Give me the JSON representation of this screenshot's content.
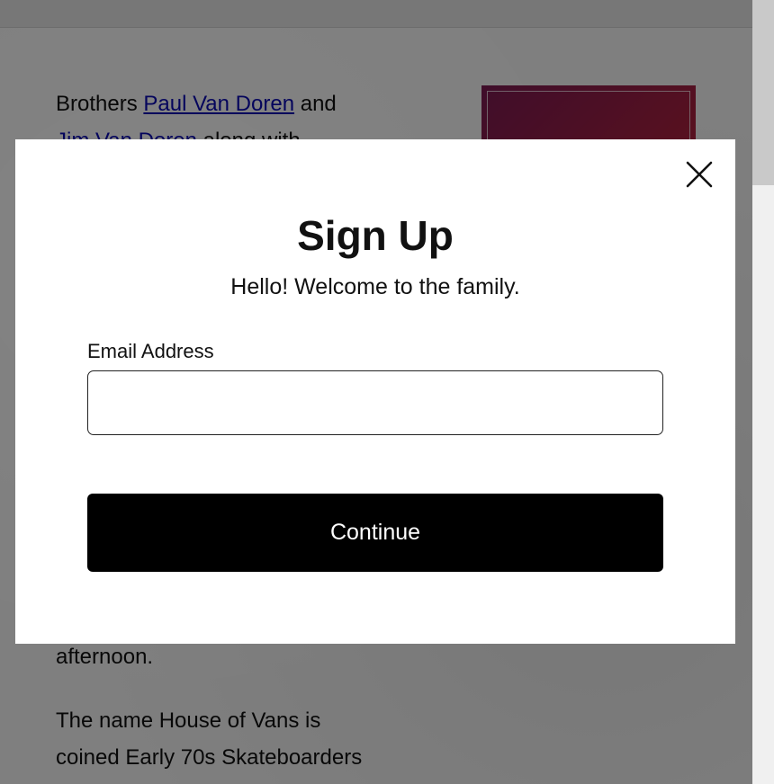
{
  "background_page": {
    "paragraph_intro": {
      "prefix": "Brothers ",
      "link_1": "Paul Van Doren",
      "middle": " and",
      "link_2": "Jim Van Doren",
      "suffix": " along with"
    },
    "paragraph_tail": "afternoon.",
    "paragraph_name_line_1": "The name House of Vans is",
    "paragraph_name_line_2": "coined Early 70s Skateboarders"
  },
  "modal": {
    "title": "Sign Up",
    "subtitle": "Hello! Welcome to the family.",
    "email_label": "Email Address",
    "email_value": "",
    "email_placeholder": "",
    "continue_label": "Continue",
    "close_icon": "close-icon"
  },
  "colors": {
    "overlay": "#000000",
    "button_bg": "#000000",
    "button_text": "#ffffff",
    "link": "#0a0ab0"
  }
}
